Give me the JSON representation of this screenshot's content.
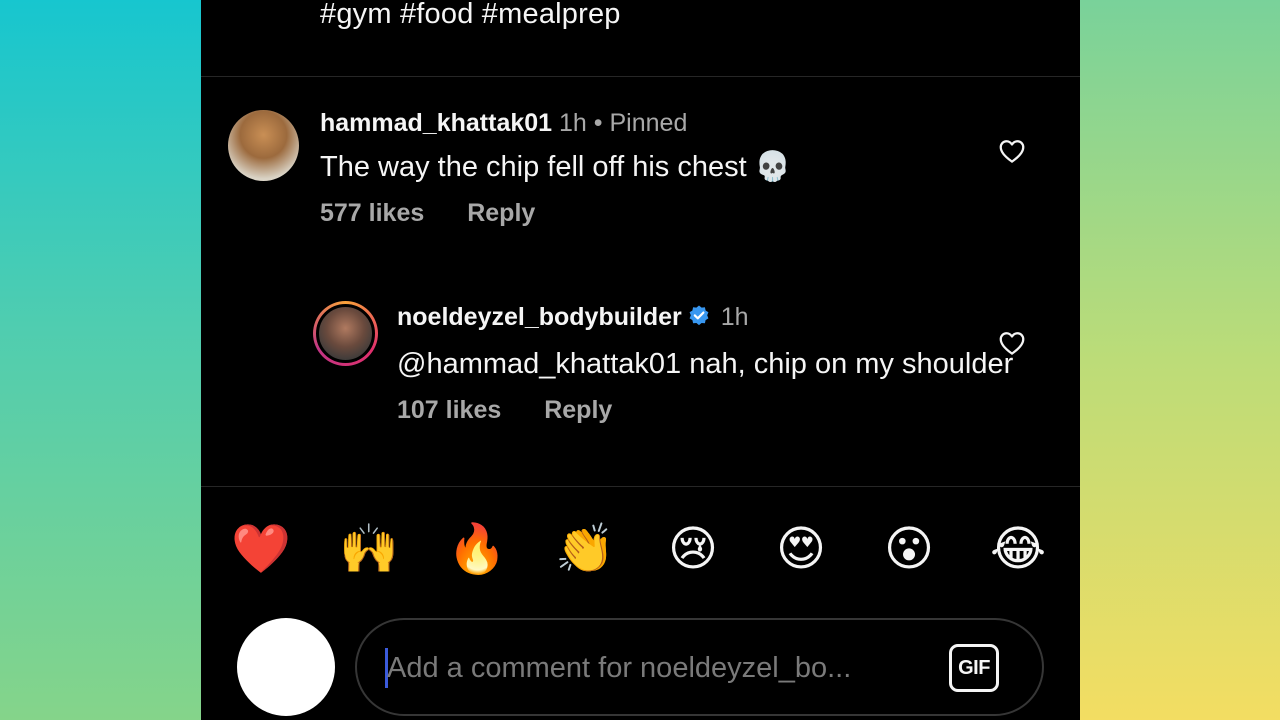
{
  "post": {
    "hashtags": "#gym #food #mealprep"
  },
  "comments": [
    {
      "username": "hammad_khattak01",
      "time": "1h",
      "separator": "•",
      "pinned": "Pinned",
      "text": "The way the chip fell off his chest 💀",
      "likes": "577 likes",
      "reply": "Reply",
      "avatar_icon": "cartoon-muscular-dog-avatar"
    },
    {
      "username": "noeldeyzel_bodybuilder",
      "verified": true,
      "time": "1h",
      "text": "@hammad_khattak01 nah, chip on my shoulder",
      "likes": "107 likes",
      "reply": "Reply",
      "avatar_icon": "bodybuilder-photo-avatar-with-story-ring"
    }
  ],
  "reactions": [
    "❤️",
    "🙌",
    "🔥",
    "👏",
    "😢",
    "😍",
    "😮",
    "😂"
  ],
  "composer": {
    "placeholder": "Add a comment for noeldeyzel_bo...",
    "gif_label": "GIF"
  },
  "colors": {
    "background": "#000000",
    "text": "#f5f5f5",
    "muted": "#a8a8a8",
    "verified": "#3897f0",
    "caret": "#3b5bdb"
  }
}
